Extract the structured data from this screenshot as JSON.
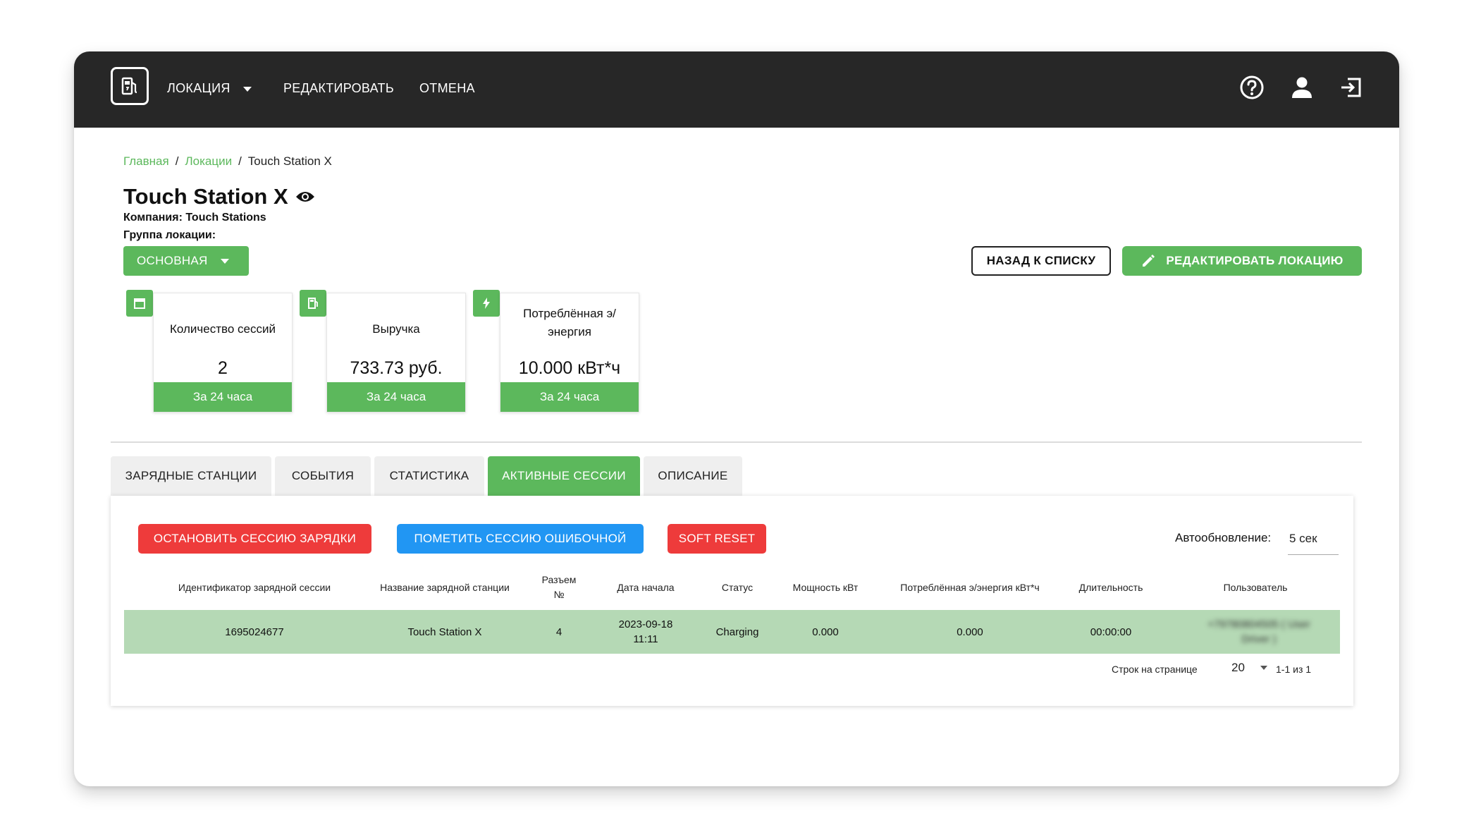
{
  "topbar": {
    "logo_icon": "fuel-station-icon",
    "nav": [
      {
        "label": "ЛОКАЦИЯ",
        "has_caret": true
      },
      {
        "label": "РЕДАКТИРОВАТЬ"
      },
      {
        "label": "ОТМЕНА"
      }
    ],
    "icons": [
      "help-icon",
      "user-icon",
      "logout-icon"
    ]
  },
  "breadcrumb": {
    "items": [
      "Главная",
      "Локации",
      "Touch Station X"
    ],
    "separator": "/"
  },
  "page": {
    "title": "Touch Station X",
    "company": "Компания: Touch Stations",
    "group_label": "Группа локации:",
    "group_value": "ОСНОВНАЯ"
  },
  "actions": {
    "back_label": "НАЗАД К СПИСКУ",
    "edit_label": "РЕДАКТИРОВАТЬ ЛОКАЦИЮ"
  },
  "stats": [
    {
      "icon": "calendar-icon",
      "label": "Количество сессий",
      "value": "2",
      "footer": "За 24 часа"
    },
    {
      "icon": "fuel-station-icon",
      "label": "Выручка",
      "value": "733.73 руб.",
      "footer": "За 24 часа"
    },
    {
      "icon": "lightning-icon",
      "label": "Потреблённая э/энергия",
      "value": "10.000 кВт*ч",
      "footer": "За 24 часа"
    }
  ],
  "tabs": [
    {
      "label": "ЗАРЯДНЫЕ СТАНЦИИ",
      "active": false
    },
    {
      "label": "СОБЫТИЯ",
      "active": false
    },
    {
      "label": "СТАТИСТИКА",
      "active": false
    },
    {
      "label": "АКТИВНЫЕ СЕССИИ",
      "active": true
    },
    {
      "label": "ОПИСАНИЕ",
      "active": false
    }
  ],
  "panel": {
    "buttons": [
      {
        "label": "ОСТАНОВИТЬ СЕССИЮ ЗАРЯДКИ",
        "color": "#ee3b3b"
      },
      {
        "label": "ПОМЕТИТЬ СЕССИЮ ОШИБОЧНОЙ",
        "color": "#2196f3"
      },
      {
        "label": "SOFT RESET",
        "color": "#ee3b3b"
      }
    ],
    "autoupdate_label": "Автообновление:",
    "autoupdate_value": "5 сек",
    "columns": [
      "Идентификатор зарядной сессии",
      "Название зарядной станции",
      "Разъем №",
      "Дата начала",
      "Статус",
      "Мощность кВт",
      "Потреблённая э/энергия кВт*ч",
      "Длительность",
      "Пользователь"
    ],
    "rows": [
      [
        "1695024677",
        "Touch Station X",
        "4",
        "2023-09-18 11:11",
        "Charging",
        "0.000",
        "0.000",
        "00:00:00",
        "+79780804505 ( User Driver )"
      ]
    ],
    "rows_per_page_label": "Строк на странице",
    "rows_per_page_value": "20",
    "pagination_text": "1-1 из 1"
  },
  "colors": {
    "topbar_bg": "#272727",
    "accent_green": "#5cb85c",
    "row_highlight": "#b5d9b5",
    "danger": "#ee3b3b",
    "info": "#2196f3"
  }
}
